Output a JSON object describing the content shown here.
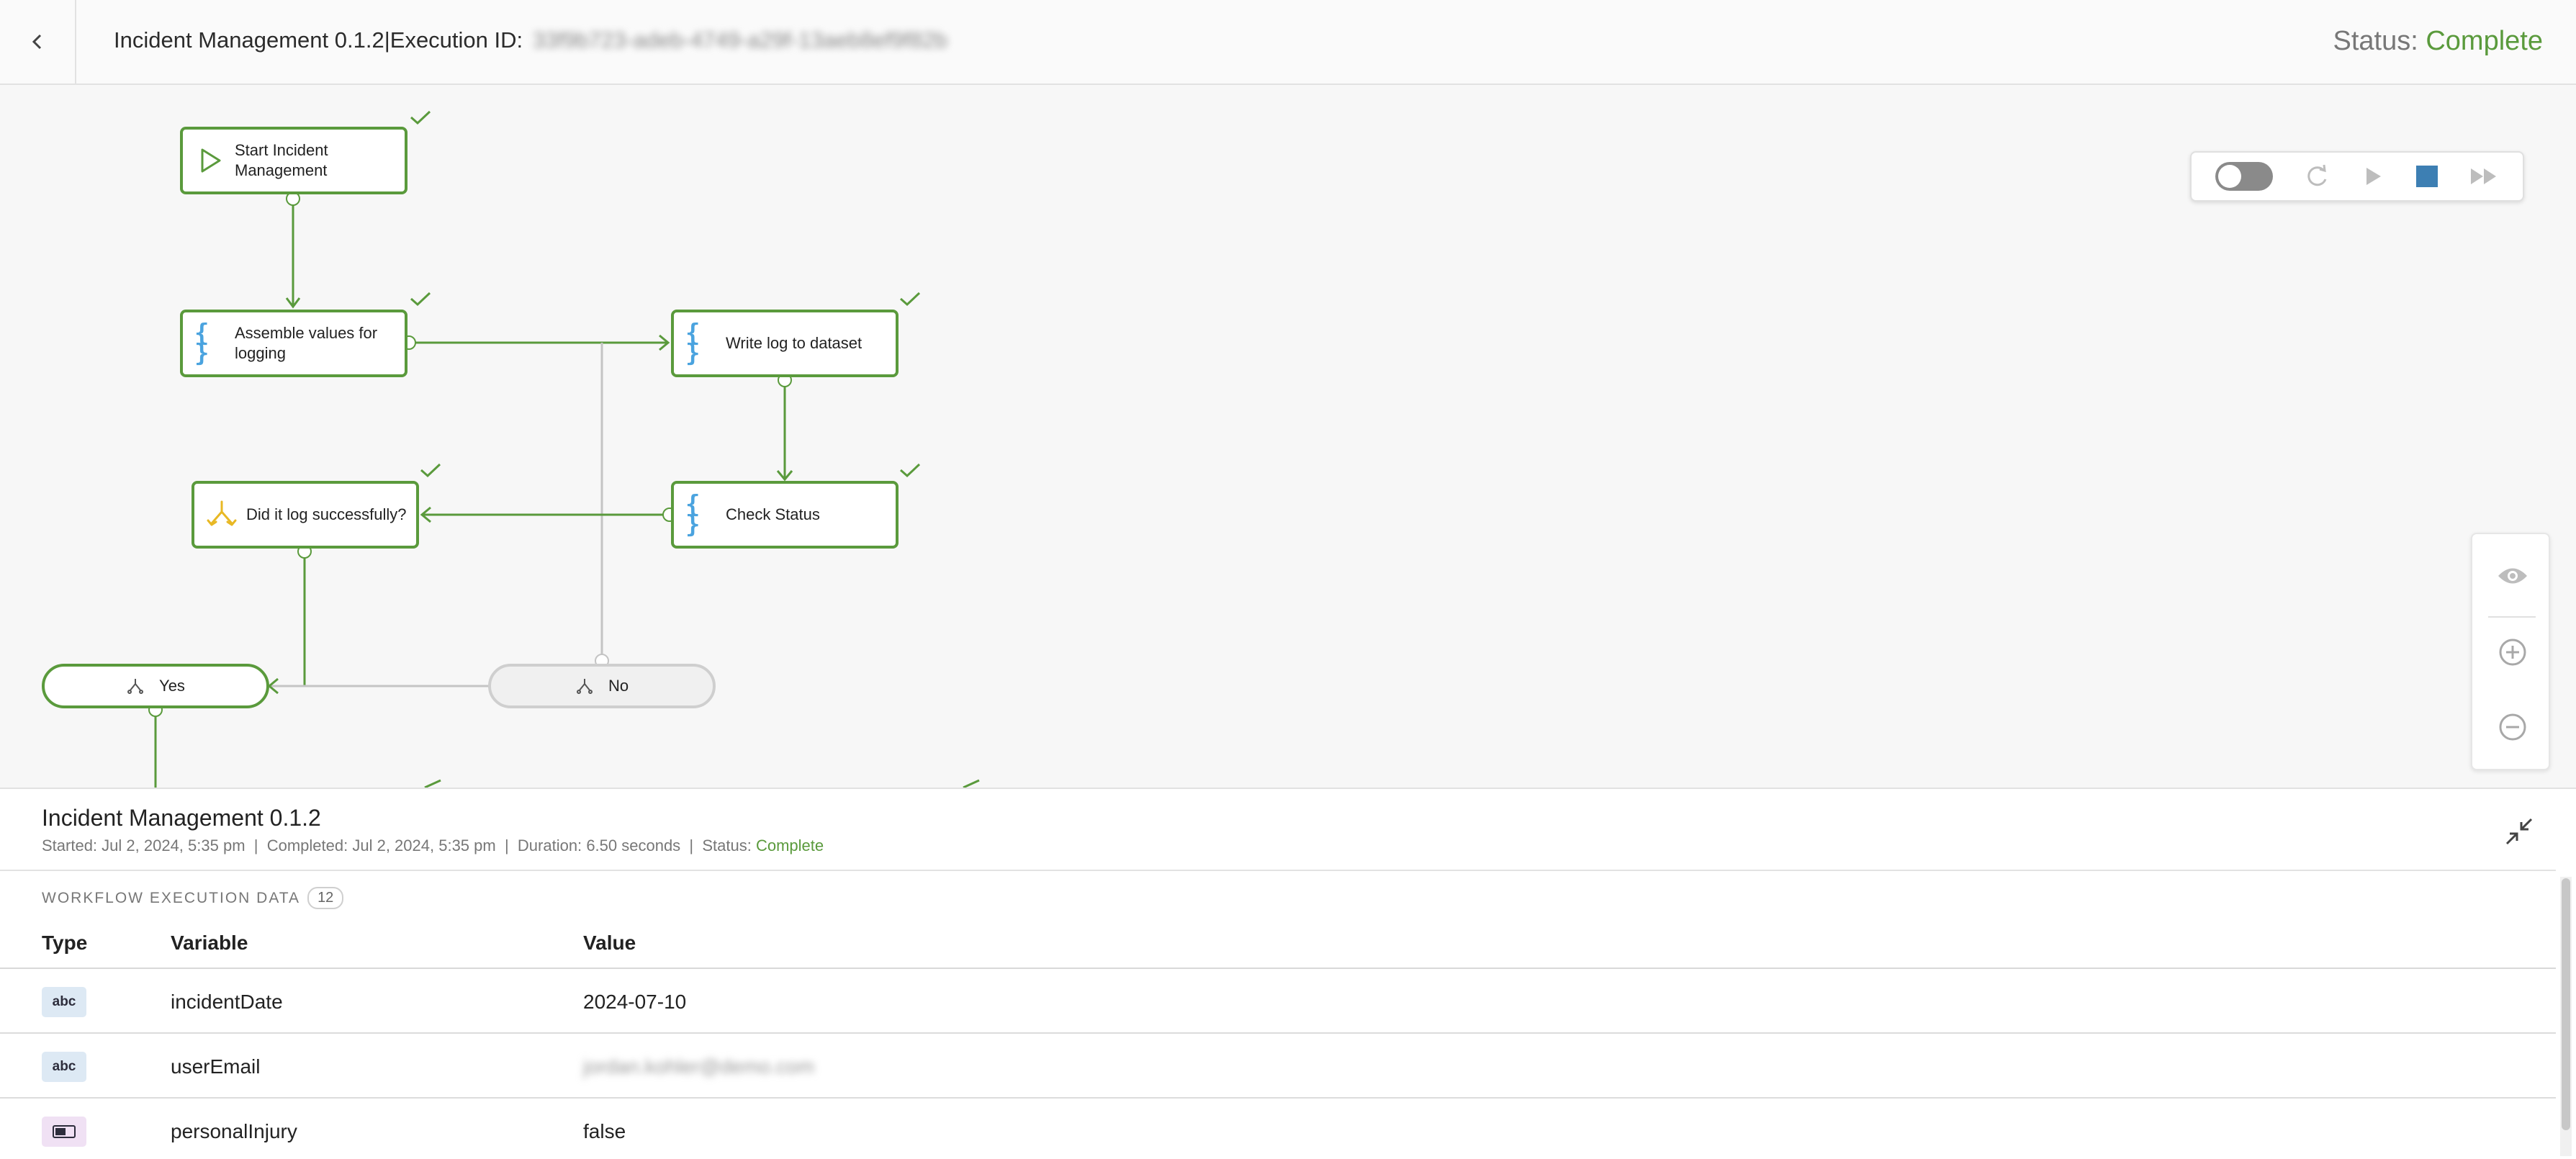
{
  "header": {
    "workflow_name": "Incident Management 0.1.2",
    "separator": "|",
    "execution_id_label": "Execution ID:",
    "execution_id_value": "33f9b723-adeb-4749-a29f-13aeb8ef9f82b",
    "status_label": "Status:",
    "status_value": "Complete"
  },
  "canvas": {
    "nodes": {
      "start": "Start Incident Management",
      "assemble": "Assemble values for logging",
      "write_log": "Write log to dataset",
      "check_status": "Check Status",
      "decision": "Did it log successfully?"
    },
    "branches": {
      "yes": "Yes",
      "no": "No"
    }
  },
  "panel": {
    "title": "Incident Management 0.1.2",
    "started_label": "Started:",
    "started_value": "Jul 2, 2024, 5:35 pm",
    "completed_label": "Completed:",
    "completed_value": "Jul 2, 2024, 5:35 pm",
    "duration_label": "Duration:",
    "duration_value": "6.50 seconds",
    "status_label": "Status:",
    "status_value": "Complete",
    "sep": "|",
    "section_label": "WORKFLOW EXECUTION DATA",
    "count": "12",
    "columns": {
      "type": "Type",
      "variable": "Variable",
      "value": "Value"
    },
    "rows": [
      {
        "type_icon": "abc",
        "variable": "incidentDate",
        "value": "2024-07-10"
      },
      {
        "type_icon": "abc",
        "variable": "userEmail",
        "value": "jordan.kohler@demo.com"
      },
      {
        "type_icon": "",
        "variable": "personalInjury",
        "value": "false"
      }
    ]
  },
  "colors": {
    "success": "#5a9a3c",
    "stop": "#3d7fb3",
    "braces": "#4aa3df",
    "decision": "#e8b824"
  }
}
